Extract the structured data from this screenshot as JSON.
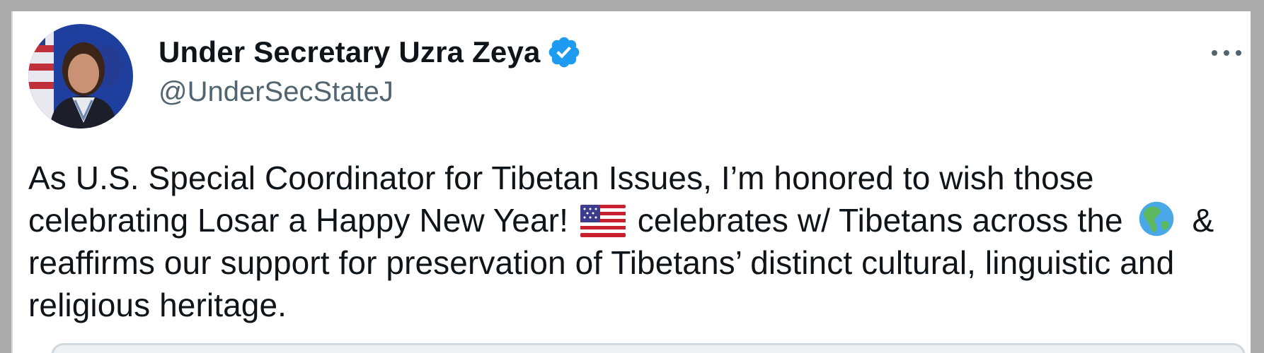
{
  "tweet": {
    "author": {
      "display_name": "Under Secretary Uzra Zeya",
      "handle": "@UnderSecStateJ",
      "verified": true,
      "avatar_icon": "profile-photo",
      "verified_icon": "verified-badge-icon"
    },
    "more_icon": "more-options-icon",
    "text": {
      "segment_1": "As U.S. Special Coordinator for Tibetan Issues, I’m honored to wish those celebrating Losar a Happy New Year!",
      "emoji_1": "us-flag-emoji",
      "segment_2": "celebrates w/ Tibetans across the",
      "emoji_2": "globe-americas-emoji",
      "segment_3": "& reaffirms our support for preservation of Tibetans’ distinct cultural, linguistic and religious heritage."
    }
  },
  "colors": {
    "background": "#acacac",
    "card": "#ffffff",
    "text_primary": "#0f1419",
    "text_secondary": "#536471",
    "verified_blue": "#1d9bf0"
  }
}
